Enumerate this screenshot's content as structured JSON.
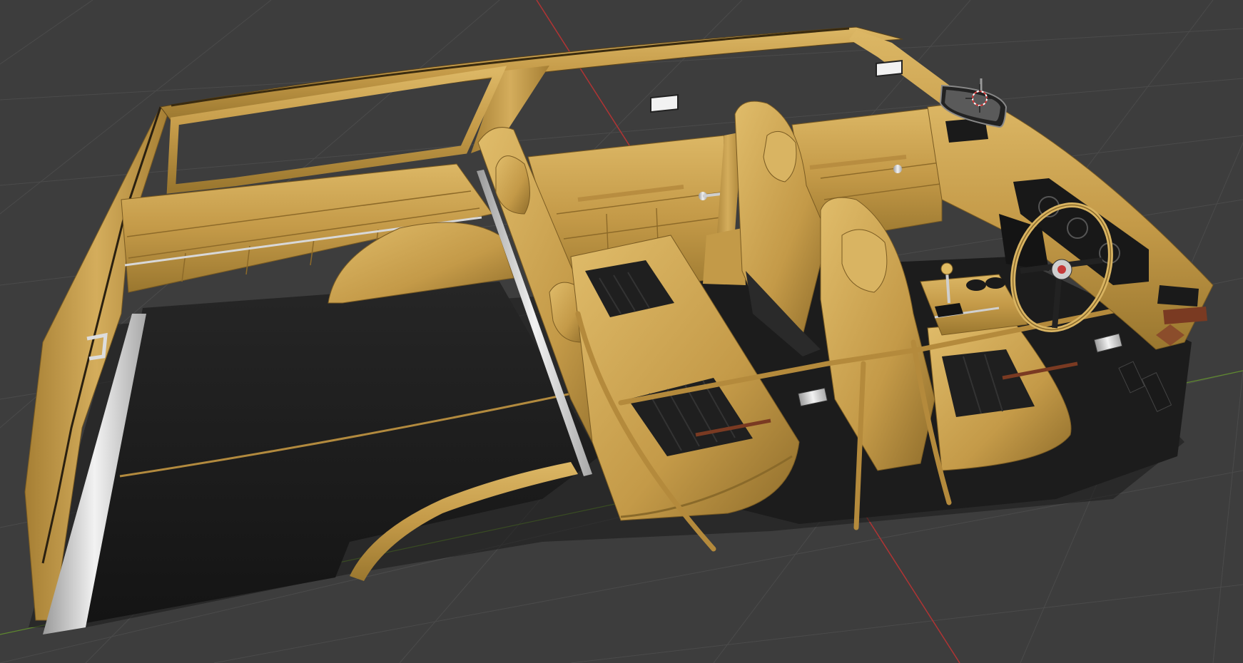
{
  "viewport": {
    "mode": "3d-viewport",
    "background_color": "#3d3d3d",
    "grid_color": "#4b4b4b",
    "axis_x_color": "#b03434",
    "axis_y_color": "#5f8a2e",
    "object_name": "",
    "overlay_text": ""
  },
  "model": {
    "subject": "car-interior",
    "trim_color": "#c49a48",
    "trim_highlight": "#e2bf6e",
    "trim_shadow": "#8a6a2a",
    "carpet_color": "#1e1e1e",
    "chrome_color": "#cfcfcf"
  },
  "cursor": {
    "icon": "3d-cursor-icon",
    "colors": [
      "#ffffff",
      "#d23a3a"
    ]
  }
}
